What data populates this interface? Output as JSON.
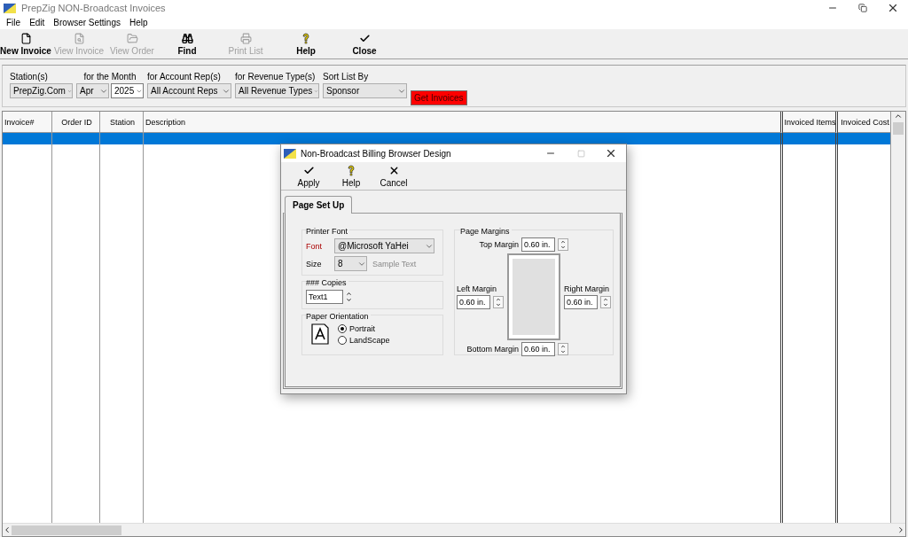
{
  "window": {
    "title": "PrepZig NON-Broadcast Invoices"
  },
  "menu": [
    {
      "label": "File"
    },
    {
      "label": "Edit"
    },
    {
      "label": "Browser Settings"
    },
    {
      "label": "Help"
    }
  ],
  "toolbar": [
    {
      "label": "New Invoice",
      "disabled": false
    },
    {
      "label": "View Invoice",
      "disabled": true
    },
    {
      "label": "View Order",
      "disabled": true
    },
    {
      "label": "Find",
      "disabled": false
    },
    {
      "label": "Print List",
      "disabled": true
    },
    {
      "label": "Help",
      "disabled": false
    },
    {
      "label": "Close",
      "disabled": false
    }
  ],
  "filters": [
    {
      "label": "Station(s)",
      "fields": [
        {
          "value": "PrepZig.Com",
          "kind": "select"
        }
      ]
    },
    {
      "label": "for the Month",
      "fields": [
        {
          "value": "Apr",
          "kind": "select"
        },
        {
          "value": "2025",
          "kind": "combo"
        }
      ]
    },
    {
      "label": "for Account Rep(s)",
      "fields": [
        {
          "value": "All Account Reps",
          "kind": "select"
        }
      ]
    },
    {
      "label": "for Revenue Type(s)",
      "fields": [
        {
          "value": "All Revenue Types",
          "kind": "select"
        }
      ]
    },
    {
      "label": "Sort List By",
      "fields": [
        {
          "value": "Sponsor",
          "kind": "select"
        }
      ]
    }
  ],
  "get_button": "Get Invoices",
  "table": {
    "columns": [
      "Invoice#",
      "Order ID",
      "Station",
      "Description",
      "Invoiced Items",
      "Invoiced Cost"
    ],
    "rows": [
      {
        "selected": true
      }
    ]
  },
  "dialog": {
    "title": "Non-Broadcast Billing Browser Design",
    "toolbar": [
      {
        "label": "Apply"
      },
      {
        "label": "Help"
      },
      {
        "label": "Cancel"
      }
    ],
    "tabs": [
      {
        "label": "Page Set Up",
        "selected": true
      }
    ],
    "printer_font": {
      "title": "Printer Font",
      "font_label": "Font",
      "font_value": "@Microsoft YaHei",
      "size_label": "Size",
      "size_value": "8",
      "sample": "Sample Text"
    },
    "copies": {
      "title": "### Copies",
      "value": "Text1"
    },
    "orientation": {
      "title": "Paper Orientation",
      "options": [
        {
          "label": "Portrait",
          "selected": true
        },
        {
          "label": "LandScape",
          "selected": false
        }
      ]
    },
    "margins": {
      "title": "Page Margins",
      "top": {
        "label": "Top Margin",
        "value": "0.60 in."
      },
      "left": {
        "label": "Left Margin",
        "value": "0.60 in."
      },
      "right": {
        "label": "Right Margin",
        "value": "0.60 in."
      },
      "bottom": {
        "label": "Bottom Margin",
        "value": "0.60 in."
      }
    }
  }
}
